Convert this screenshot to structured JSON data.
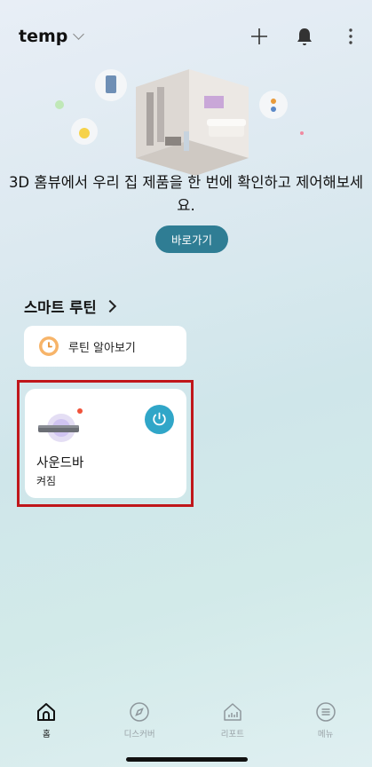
{
  "header": {
    "home_name": "temp",
    "icons": [
      "plus-icon",
      "bell-icon",
      "more-icon"
    ]
  },
  "hero": {
    "message": "3D 홈뷰에서 우리 집 제품을 한 번에 확인하고 제어해보세요.",
    "button_label": "바로가기"
  },
  "routines": {
    "section_title": "스마트 루틴",
    "learn_label": "루틴 알아보기"
  },
  "device": {
    "name": "사운드바",
    "status": "켜짐"
  },
  "nav": {
    "items": [
      {
        "label": "홈",
        "icon": "home-icon",
        "active": true
      },
      {
        "label": "디스커버",
        "icon": "compass-icon",
        "active": false
      },
      {
        "label": "리포트",
        "icon": "report-icon",
        "active": false
      },
      {
        "label": "메뉴",
        "icon": "menu-icon",
        "active": false
      }
    ]
  },
  "colors": {
    "accent": "#2f7d94",
    "power": "#30a6c8",
    "highlight": "#c0171b"
  }
}
